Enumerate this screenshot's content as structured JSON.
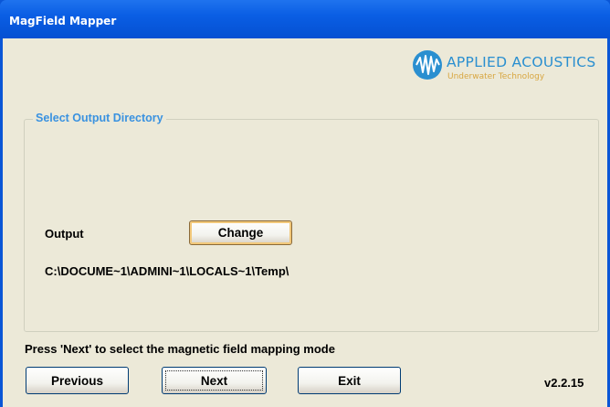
{
  "window": {
    "title": "MagField Mapper"
  },
  "logo": {
    "name": "APPLIED ACOUSTICS",
    "tagline": "Underwater Technology",
    "colors": {
      "name": "#2a8fd0",
      "tagline": "#d8a640"
    }
  },
  "group": {
    "legend": "Select Output Directory",
    "output_label": "Output",
    "change_button": "Change",
    "output_path": "C:\\DOCUME~1\\ADMINI~1\\LOCALS~1\\Temp\\"
  },
  "footer": {
    "instruction": "Press 'Next' to select the magnetic field mapping mode",
    "previous_button": "Previous",
    "next_button": "Next",
    "exit_button": "Exit",
    "version": "v2.2.15"
  },
  "colors": {
    "titlebar": "#0a5ee4",
    "client_bg": "#ece9d8",
    "legend": "#3a92e0"
  }
}
